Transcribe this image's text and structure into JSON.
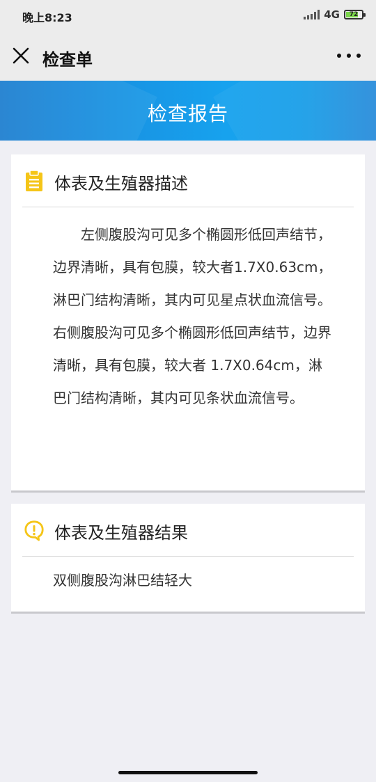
{
  "status_bar": {
    "time": "晚上8:23",
    "network": "4G",
    "battery": "72",
    "icons": [
      "signal-icon",
      "battery-icon"
    ]
  },
  "nav": {
    "title": "检查单",
    "close_icon": "close-icon",
    "more_icon": "more-icon"
  },
  "banner": {
    "title": "检查报告",
    "colors": {
      "start": "#1e7fd0",
      "end": "#17a2ee"
    }
  },
  "description_card": {
    "icon": "clipboard-icon",
    "icon_color": "#f5c518",
    "title": "体表及生殖器描述",
    "body": "左侧腹股沟可见多个椭圆形低回声结节，边界清晰，具有包膜，较大者1.7X0.63cm，淋巴门结构清晰，其内可见星点状血流信号。　　右侧腹股沟可见多个椭圆形低回声结节，边界清晰，具有包膜，较大者 1.7X0.64cm，淋巴门结构清晰，其内可见条状血流信号。"
  },
  "result_card": {
    "icon": "alert-bubble-icon",
    "icon_color": "#f5c518",
    "title": "体表及生殖器结果",
    "body": "双侧腹股沟淋巴结轻大"
  }
}
